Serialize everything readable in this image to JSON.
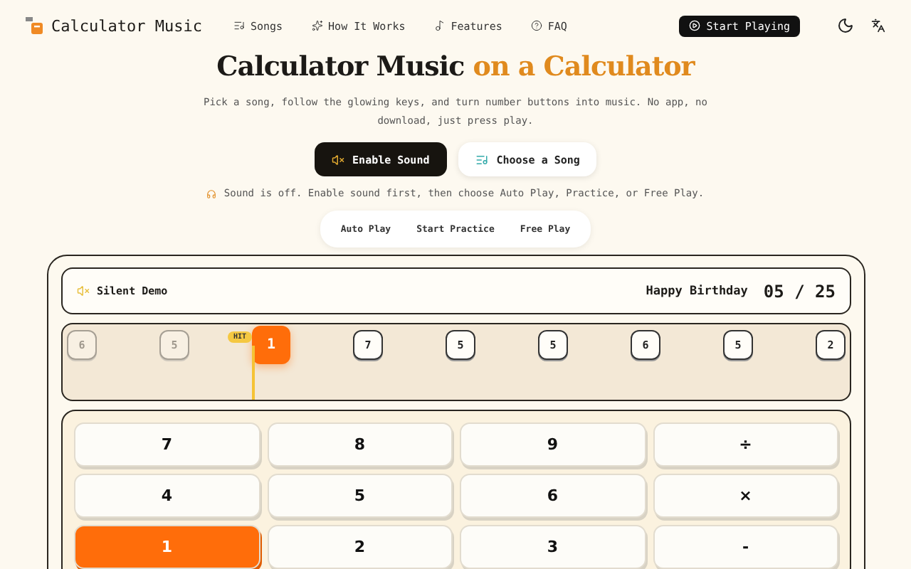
{
  "nav": {
    "brand": "Calculator Music",
    "links": [
      {
        "label": "Songs"
      },
      {
        "label": "How It Works"
      },
      {
        "label": "Features"
      },
      {
        "label": "FAQ"
      }
    ],
    "cta": "Start Playing"
  },
  "hero": {
    "title_main": "Calculator Music",
    "title_accent": "on a Calculator",
    "subtitle": "Pick a song, follow the glowing keys, and turn number buttons into music. No app, no download, just press play.",
    "primary_button": "Enable Sound",
    "secondary_button": "Choose a Song",
    "status": "Sound is off. Enable sound first, then choose Auto Play, Practice, or Free Play."
  },
  "modes": [
    {
      "label": "Auto Play",
      "selected": false
    },
    {
      "label": "Start Practice",
      "selected": false
    },
    {
      "label": "Free Play",
      "selected": false
    }
  ],
  "player": {
    "status": "Silent Demo",
    "song": "Happy Birthday",
    "progress": "05 / 25",
    "hit_badge": "HIT",
    "notes": [
      {
        "label": "6",
        "played": true,
        "current": false
      },
      {
        "label": "5",
        "played": true,
        "current": false
      },
      {
        "label": "1",
        "played": false,
        "current": true
      },
      {
        "label": "7",
        "played": false,
        "current": false
      },
      {
        "label": "5",
        "played": false,
        "current": false
      },
      {
        "label": "5",
        "played": false,
        "current": false
      },
      {
        "label": "6",
        "played": false,
        "current": false
      },
      {
        "label": "5",
        "played": false,
        "current": false
      },
      {
        "label": "2",
        "played": false,
        "current": false
      }
    ],
    "keys": [
      {
        "label": "7",
        "active": false
      },
      {
        "label": "8",
        "active": false
      },
      {
        "label": "9",
        "active": false
      },
      {
        "label": "÷",
        "active": false
      },
      {
        "label": "4",
        "active": false
      },
      {
        "label": "5",
        "active": false
      },
      {
        "label": "6",
        "active": false
      },
      {
        "label": "×",
        "active": false
      },
      {
        "label": "1",
        "active": true
      },
      {
        "label": "2",
        "active": false
      },
      {
        "label": "3",
        "active": false
      },
      {
        "label": "-",
        "active": false
      }
    ]
  }
}
